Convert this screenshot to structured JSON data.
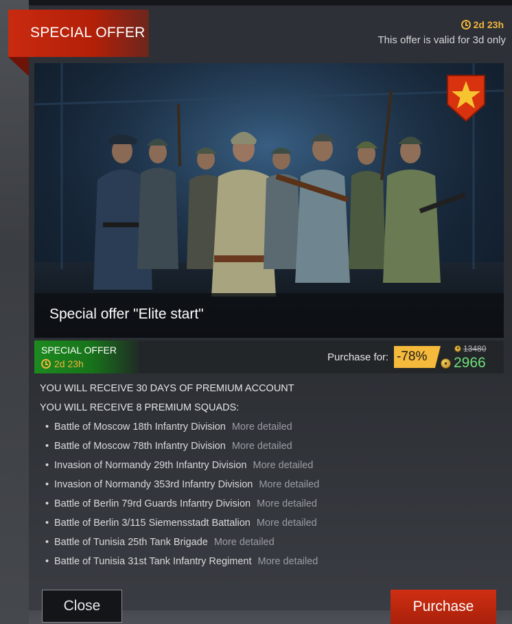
{
  "header": {
    "title": "SPECIAL OFFER",
    "timer": "2d 23h",
    "validity_text": "This offer is valid for 3d only"
  },
  "hero": {
    "caption": "Special offer \"Elite start\""
  },
  "price_bar": {
    "tag_title": "SPECIAL OFFER",
    "tag_timer": "2d 23h",
    "purchase_for_label": "Purchase for:",
    "discount": "-78%",
    "old_price": "13480",
    "new_price": "2966",
    "currency_icon": "gold-coin-icon"
  },
  "rewards": {
    "premium_account": "YOU WILL RECEIVE 30 DAYS OF PREMIUM ACCOUNT",
    "squads_heading": "YOU WILL RECEIVE 8 PREMIUM SQUADS:",
    "more_label": "More detailed",
    "squads": [
      {
        "name": "Battle of Moscow 18th Infantry Division",
        "more": "More detailed"
      },
      {
        "name": "Battle of Moscow 78th Infantry Division",
        "more": "More detailed"
      },
      {
        "name": "Invasion of Normandy 29th Infantry Division",
        "more": "More detailed"
      },
      {
        "name": "Invasion of Normandy 353rd Infantry Division",
        "more": "More detailed"
      },
      {
        "name": "Battle of Berlin 79rd Guards Infantry Division",
        "more": "More detailed"
      },
      {
        "name": "Battle of Berlin 3/115 Siemensstadt Battalion",
        "more": "More detailed"
      },
      {
        "name": "Battle of Tunisia 25th Tank Brigade",
        "more": "More detailed"
      },
      {
        "name": "Battle of Tunisia 31st Tank Infantry Regiment",
        "more": "More detailed"
      }
    ]
  },
  "buttons": {
    "close": "Close",
    "purchase": "Purchase"
  },
  "colors": {
    "accent_red": "#c92a10",
    "timer_gold": "#f0b63c",
    "tag_green": "#1d8a20",
    "price_green": "#6fe07a",
    "discount_yellow": "#f5b93b"
  }
}
